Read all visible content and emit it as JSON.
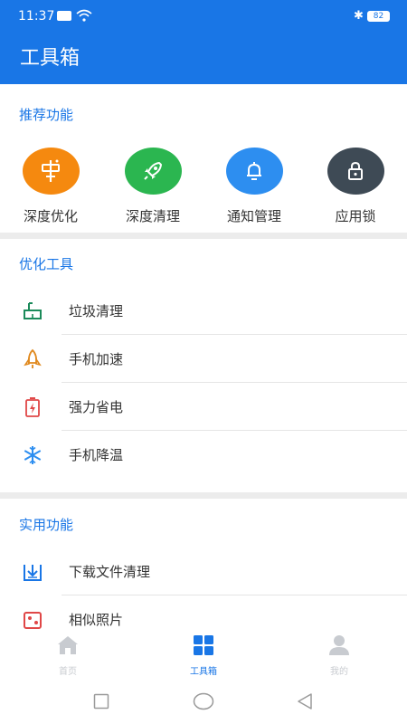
{
  "status": {
    "time": "11:37",
    "battery": "82"
  },
  "header": {
    "title": "工具箱"
  },
  "recommended": {
    "title": "推荐功能",
    "items": [
      {
        "label": "深度优化",
        "color": "#f5890f",
        "icon": "optimize-icon"
      },
      {
        "label": "深度清理",
        "color": "#2bb650",
        "icon": "rocket-icon"
      },
      {
        "label": "通知管理",
        "color": "#2d8ef0",
        "icon": "bell-icon"
      },
      {
        "label": "应用锁",
        "color": "#3e4a55",
        "icon": "lock-icon"
      }
    ]
  },
  "optimize": {
    "title": "优化工具",
    "items": [
      {
        "label": "垃圾清理",
        "icon": "broom-icon",
        "color": "#1b8a5a"
      },
      {
        "label": "手机加速",
        "icon": "rocket-outline-icon",
        "color": "#e0891e"
      },
      {
        "label": "强力省电",
        "icon": "battery-bolt-icon",
        "color": "#e04747"
      },
      {
        "label": "手机降温",
        "icon": "snowflake-icon",
        "color": "#2d8ef0"
      }
    ]
  },
  "utility": {
    "title": "实用功能",
    "items": [
      {
        "label": "下载文件清理",
        "icon": "download-icon",
        "color": "#1976e6"
      },
      {
        "label": "相似照片",
        "icon": "photo-icon",
        "color": "#e04747"
      }
    ]
  },
  "tabs": [
    {
      "label": "首页",
      "icon": "home-icon",
      "active": false
    },
    {
      "label": "工具箱",
      "icon": "grid-icon",
      "active": true
    },
    {
      "label": "我的",
      "icon": "person-icon",
      "active": false
    }
  ],
  "colors": {
    "accent": "#1976e6",
    "inactive": "#c8cbd0"
  }
}
